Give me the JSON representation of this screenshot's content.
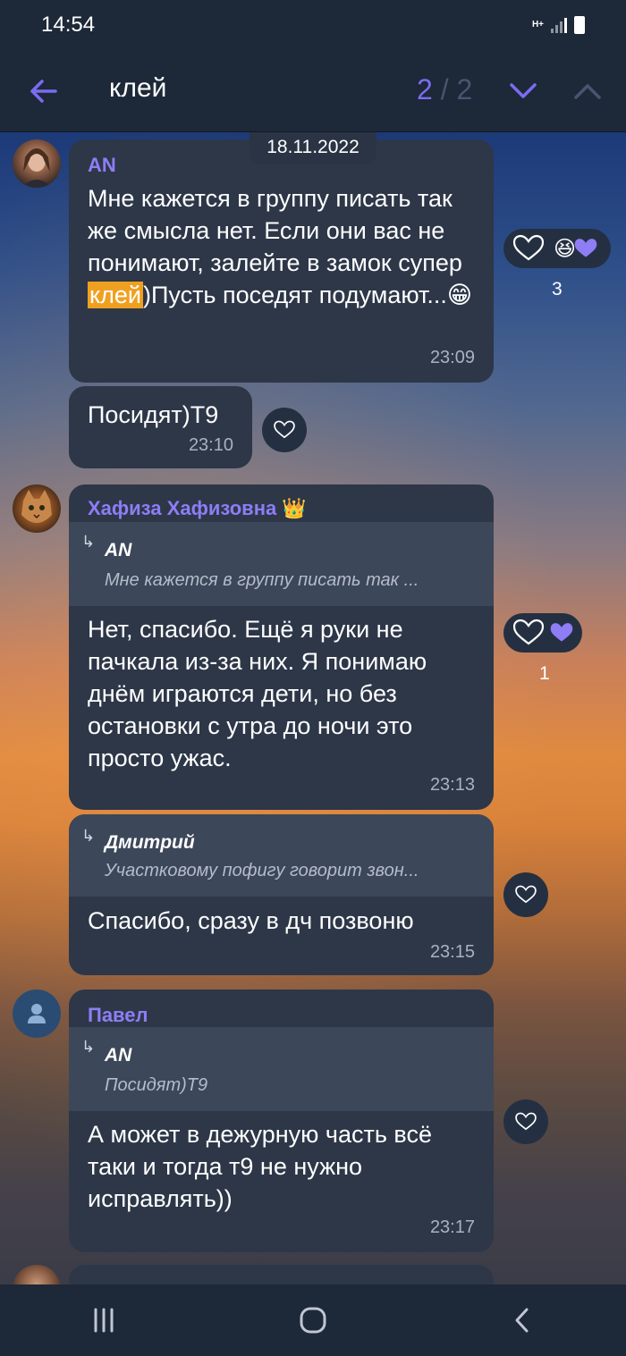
{
  "status_bar": {
    "time": "14:54",
    "network": "H+"
  },
  "search_bar": {
    "query": "клей",
    "current": "2",
    "separator": "/",
    "total": "2"
  },
  "date_label": "18.11.2022",
  "messages": [
    {
      "author": "AN",
      "text_before": "Мне кажется в группу писать так же смысла нет. Если они вас не понимают, залейте в замок супер ",
      "highlight": "клей",
      "text_after": ")Пусть поседят  подумают...😁",
      "time": "23:09",
      "reaction_count": "3"
    },
    {
      "text": "Посидят)Т9",
      "time": "23:10"
    },
    {
      "author": "Хафиза Хафизовна 👑",
      "reply_author": "AN",
      "reply_text": "Мне кажется в группу писать так ...",
      "text": "Нет, спасибо. Ещё я руки не пачкала из-за них. Я понимаю днём играются дети, но без остановки с утра до ночи это просто ужас.",
      "time": "23:13",
      "reaction_count": "1"
    },
    {
      "reply_author": "Дмитрий",
      "reply_text": "Участковому пофигу говорит звон...",
      "text": "Спасибо, сразу в дч позвоню",
      "time": "23:15"
    },
    {
      "author": "Павел",
      "reply_author": "AN",
      "reply_text": "Посидят)Т9",
      "text": "А может в дежурную часть всё таки и тогда т9 не нужно исправлять))",
      "time": "23:17"
    }
  ],
  "colors": {
    "accent": "#8e7df5",
    "bubble": "#2d3748",
    "highlight": "#f0a020"
  }
}
